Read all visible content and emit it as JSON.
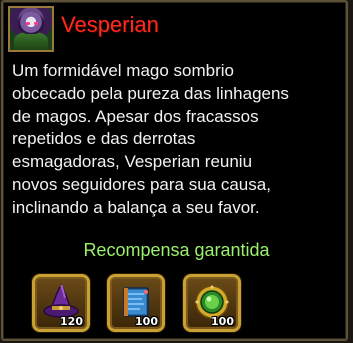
{
  "character": {
    "name": "Vesperian",
    "portrait_icon": "hooded-mage-portrait-icon"
  },
  "description": {
    "lines": [
      "Um formidável mago sombrio",
      "obcecado pela pureza das linhagens",
      "de magos. Apesar dos fracassos",
      "repetidos e das derrotas",
      "esmagadoras, Vesperian reuniu",
      "novos seguidores para sua causa,",
      "inclinando a balança a seu favor."
    ]
  },
  "rewards": {
    "title": "Recompensa garantida",
    "items": [
      {
        "icon": "purple-wizard-hat-icon",
        "quantity": "120"
      },
      {
        "icon": "blue-spellbook-icon",
        "quantity": "100"
      },
      {
        "icon": "green-gem-medallion-icon",
        "quantity": "100"
      }
    ]
  },
  "colors": {
    "name": "#ff2a1a",
    "description_text": "#f2f2f2",
    "reward_title": "#9cf06c",
    "slot_border": "#c9a032",
    "panel_border": "#5c5238"
  }
}
